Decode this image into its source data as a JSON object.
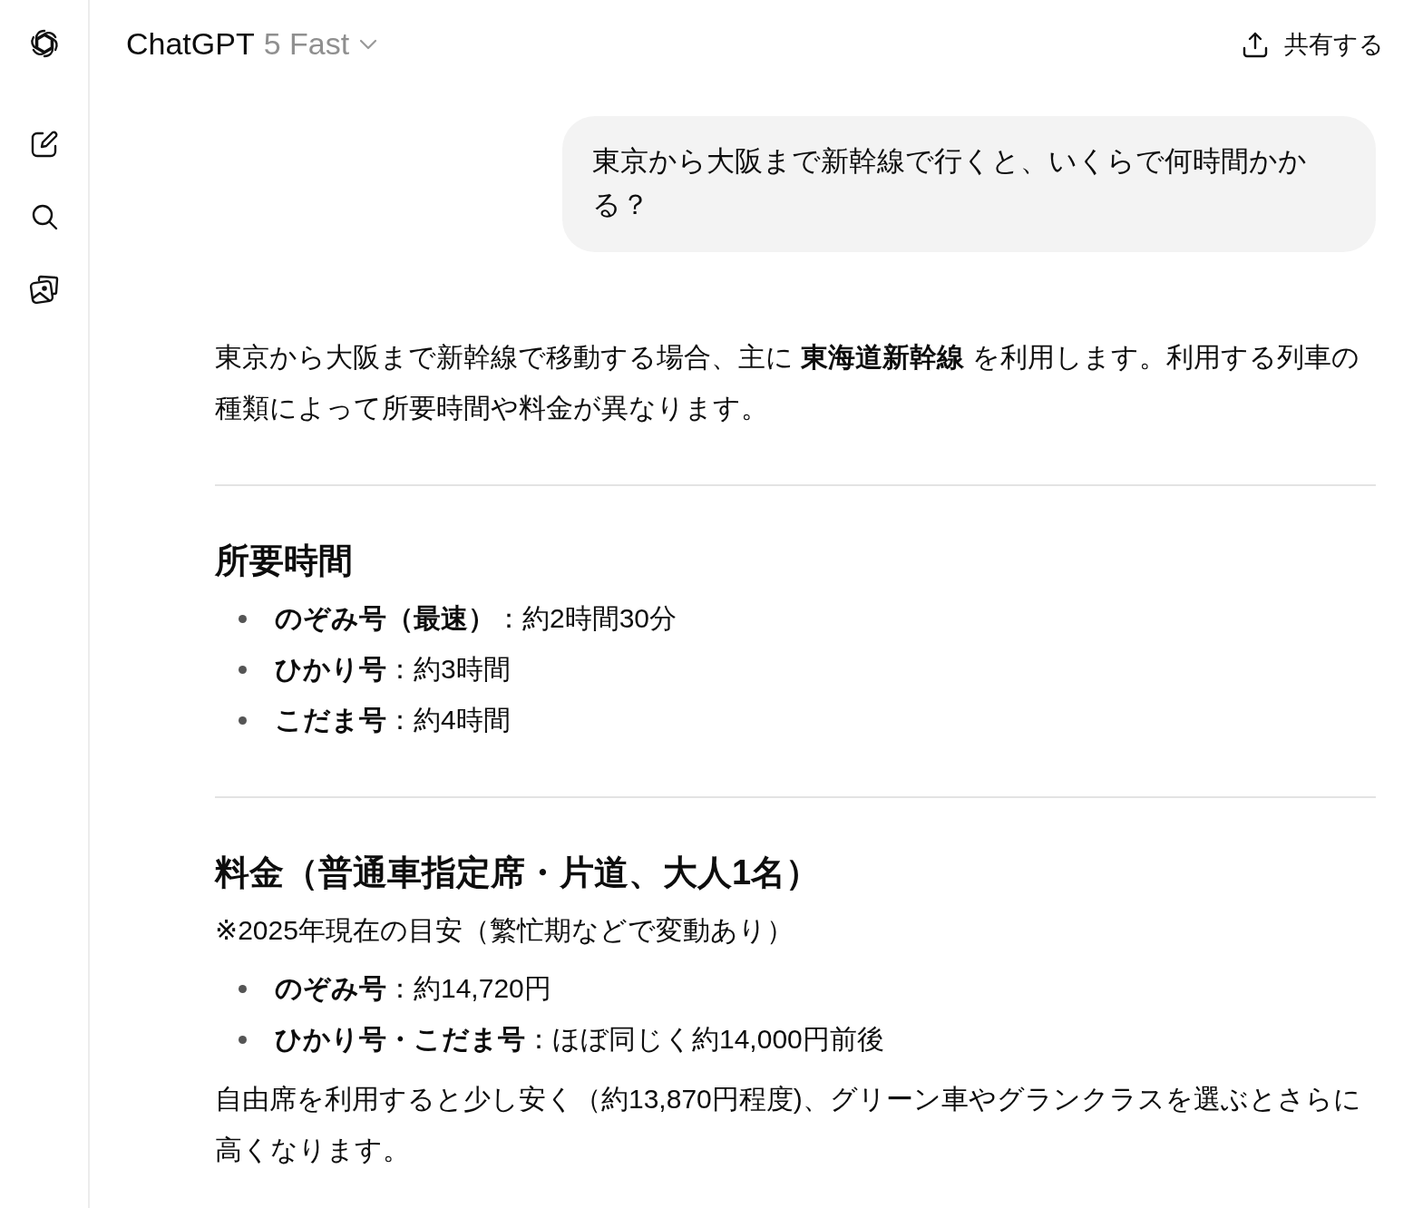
{
  "sidebar": {
    "items": [
      {
        "kind": "new-chat"
      },
      {
        "kind": "search"
      },
      {
        "kind": "images"
      }
    ]
  },
  "header": {
    "model_name": "ChatGPT",
    "model_variant": "5 Fast",
    "share_label": "共有する"
  },
  "user_message": {
    "text": "東京から大阪まで新幹線で行くと、いくらで何時間かかる？"
  },
  "response": {
    "blocks": [
      {
        "kind": "paragraph",
        "text": "東京から大阪まで新幹線で移動する場合、主に **東海道新幹線** を利用します。利用する列車の種類によって所要時間や料金が異なります。"
      },
      {
        "kind": "rule"
      },
      {
        "kind": "heading",
        "text": "所要時間"
      },
      {
        "kind": "list",
        "items": [
          "**のぞみ号（最速）**：約2時間30分",
          "**ひかり号**：約3時間",
          "**こだま号**：約4時間"
        ]
      },
      {
        "kind": "rule"
      },
      {
        "kind": "heading",
        "text": "料金（普通車指定席・片道、大人1名）"
      },
      {
        "kind": "note",
        "text": "※2025年現在の目安（繁忙期などで変動あり）"
      },
      {
        "kind": "list",
        "items": [
          "**のぞみ号**：約14,720円",
          "**ひかり号・こだま号**：ほぼ同じく約14,000円前後"
        ]
      },
      {
        "kind": "paragraph",
        "text": "自由席を利用すると少し安く（約13,870円程度)、グリーン車やグランクラスを選ぶとさらに高くなります。"
      }
    ]
  }
}
